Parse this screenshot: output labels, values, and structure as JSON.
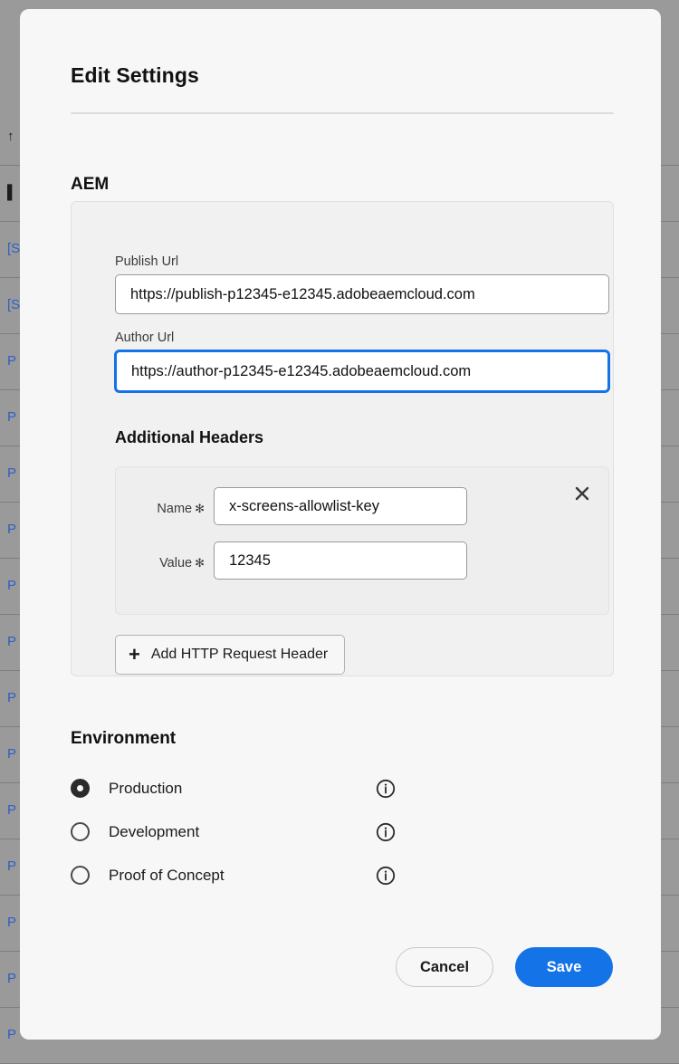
{
  "background": {
    "rows": [
      {
        "text": "↑",
        "kind": "icon-up"
      },
      {
        "text": "▌",
        "kind": "icon-book"
      },
      {
        "text": "[S",
        "kind": "link"
      },
      {
        "text": "[S",
        "kind": "link"
      },
      {
        "text": "P",
        "kind": "link"
      },
      {
        "text": "P",
        "kind": "link"
      },
      {
        "text": "P",
        "kind": "link"
      },
      {
        "text": "P",
        "kind": "link"
      },
      {
        "text": "P",
        "kind": "link"
      },
      {
        "text": "P",
        "kind": "link"
      },
      {
        "text": "P",
        "kind": "link"
      },
      {
        "text": "P",
        "kind": "link"
      },
      {
        "text": "P",
        "kind": "link"
      },
      {
        "text": "P",
        "kind": "link"
      },
      {
        "text": "P",
        "kind": "link"
      },
      {
        "text": "P",
        "kind": "link"
      },
      {
        "text": "P",
        "kind": "link"
      }
    ]
  },
  "modal": {
    "title": "Edit Settings",
    "aem": {
      "heading": "AEM",
      "publish_url": {
        "label": "Publish Url",
        "value": "https://publish-p12345-e12345.adobeaemcloud.com",
        "focused": false
      },
      "author_url": {
        "label": "Author Url",
        "value": "https://author-p12345-e12345.adobeaemcloud.com",
        "focused": true
      },
      "additional_headers": {
        "heading": "Additional Headers",
        "entries": [
          {
            "name_label": "Name",
            "name_required": "✻",
            "name_value": "x-screens-allowlist-key",
            "value_label": "Value",
            "value_required": "✻",
            "value_value": "12345",
            "remove_icon": "close-icon"
          }
        ],
        "add_button": {
          "label": "Add HTTP Request Header",
          "icon": "plus-icon"
        }
      }
    },
    "environment": {
      "heading": "Environment",
      "selected": "Production",
      "options": [
        {
          "label": "Production",
          "checked": true,
          "info_icon": "info-icon"
        },
        {
          "label": "Development",
          "checked": false,
          "info_icon": "info-icon"
        },
        {
          "label": "Proof of Concept",
          "checked": false,
          "info_icon": "info-icon"
        }
      ]
    },
    "footer": {
      "cancel_label": "Cancel",
      "save_label": "Save"
    }
  },
  "colors": {
    "accent_blue": "#1473e6",
    "modal_bg": "#f7f7f7",
    "card_bg": "#f1f1f1",
    "backdrop": "#9a9a9a"
  }
}
